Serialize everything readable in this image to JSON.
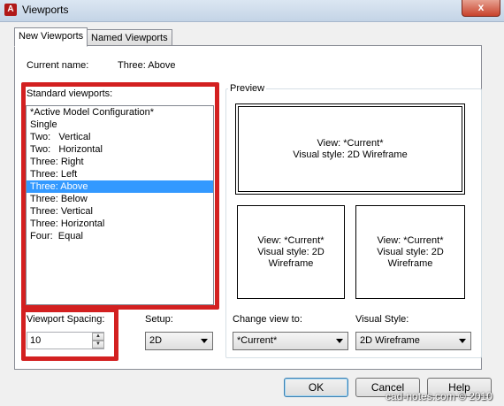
{
  "window": {
    "title": "Viewports",
    "app_icon": "A",
    "close_glyph": "x"
  },
  "tabs": [
    {
      "label": "New Viewports",
      "active": true
    },
    {
      "label": "Named Viewports",
      "active": false
    }
  ],
  "current_name": {
    "label": "Current name:",
    "value": "Three: Above"
  },
  "standard_viewports": {
    "label": "Standard viewports:",
    "items": [
      "*Active Model Configuration*",
      "Single",
      "Two:   Vertical",
      "Two:   Horizontal",
      "Three: Right",
      "Three: Left",
      "Three: Above",
      "Three: Below",
      "Three: Vertical",
      "Three: Horizontal",
      "Four:  Equal"
    ],
    "selected_index": 6
  },
  "preview": {
    "label": "Preview",
    "viewports": [
      {
        "view": "View: *Current*",
        "style": "Visual style: 2D Wireframe"
      },
      {
        "view": "View: *Current*",
        "style": "Visual style: 2D Wireframe"
      },
      {
        "view": "View: *Current*",
        "style": "Visual style: 2D Wireframe"
      }
    ]
  },
  "viewport_spacing": {
    "label": "Viewport Spacing:",
    "value": "10"
  },
  "setup": {
    "label": "Setup:",
    "value": "2D"
  },
  "change_view": {
    "label": "Change view to:",
    "value": "*Current*"
  },
  "visual_style": {
    "label": "Visual Style:",
    "value": "2D Wireframe"
  },
  "buttons": {
    "ok": "OK",
    "cancel": "Cancel",
    "help": "Help"
  },
  "watermark": "cad-notes.com © 2010",
  "colors": {
    "highlight": "#d32020",
    "selection": "#3399ff"
  }
}
